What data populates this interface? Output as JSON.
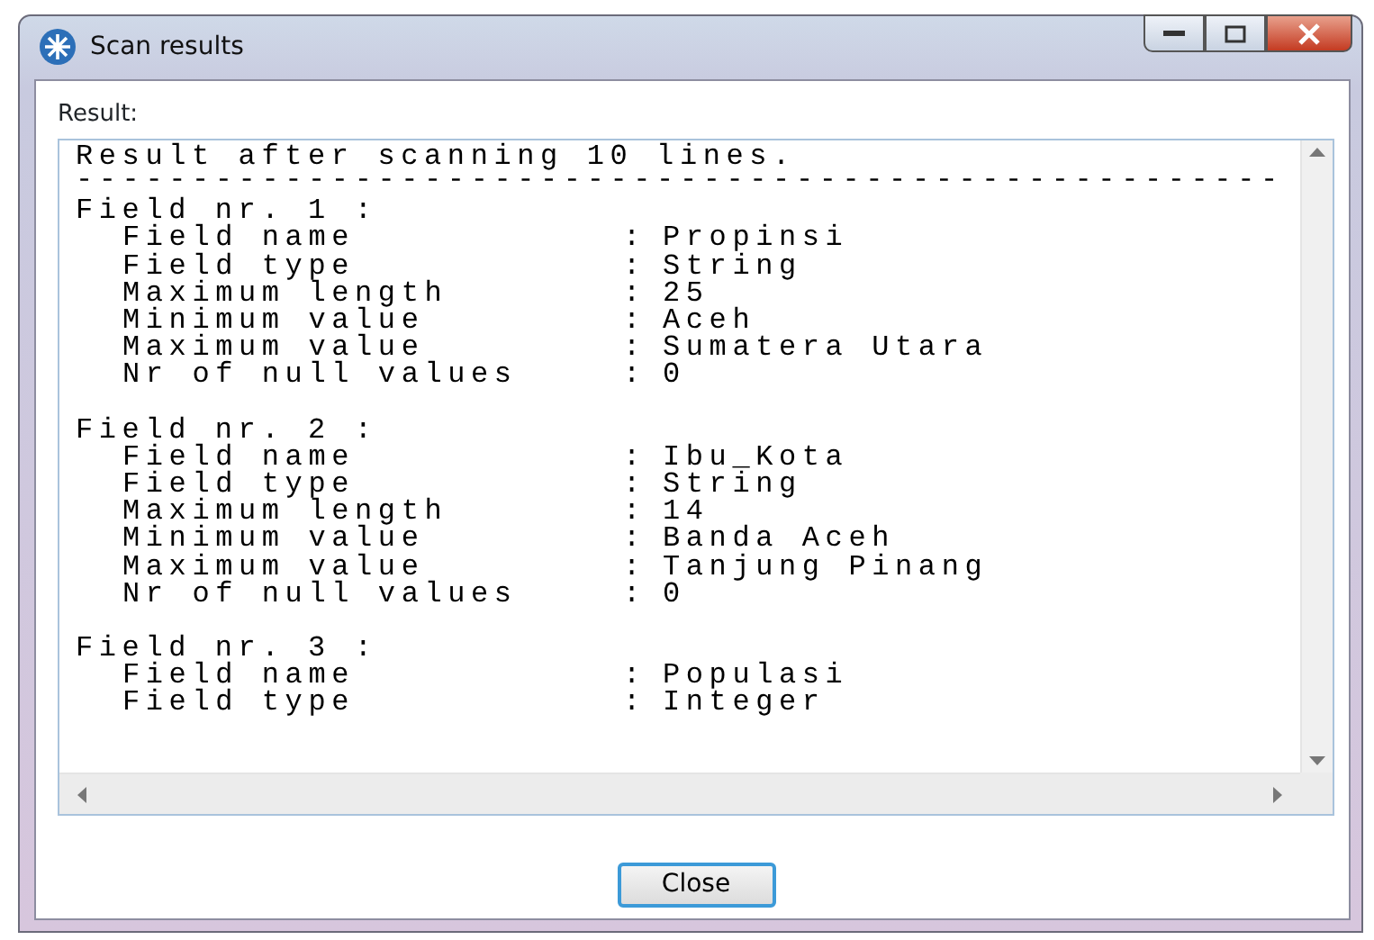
{
  "window": {
    "title": "Scan results"
  },
  "result_label": "Result:",
  "result": {
    "header": "Result after scanning 10 lines.",
    "separator": "----------------------------------------------------",
    "fields": [
      {
        "heading": "Field nr. 1 :",
        "rows": [
          {
            "label": "Field name",
            "colon": ":",
            "value": "Propinsi"
          },
          {
            "label": "Field type",
            "colon": ":",
            "value": "String"
          },
          {
            "label": "Maximum length",
            "colon": ":",
            "value": "25"
          },
          {
            "label": "Minimum value",
            "colon": ":",
            "value": "Aceh"
          },
          {
            "label": "Maximum value",
            "colon": ":",
            "value": "Sumatera Utara"
          },
          {
            "label": "Nr of null values",
            "colon": ":",
            "value": "0"
          }
        ]
      },
      {
        "heading": "Field nr. 2 :",
        "rows": [
          {
            "label": "Field name",
            "colon": ":",
            "value": "Ibu_Kota"
          },
          {
            "label": "Field type",
            "colon": ":",
            "value": "String"
          },
          {
            "label": "Maximum length",
            "colon": ":",
            "value": "14"
          },
          {
            "label": "Minimum value",
            "colon": ":",
            "value": "Banda Aceh"
          },
          {
            "label": "Maximum value",
            "colon": ":",
            "value": "Tanjung Pinang"
          },
          {
            "label": "Nr of null values",
            "colon": ":",
            "value": "0"
          }
        ]
      },
      {
        "heading": "Field nr. 3 :",
        "rows": [
          {
            "label": "Field name",
            "colon": ":",
            "value": "Populasi"
          },
          {
            "label": "Field type",
            "colon": ":",
            "value": "Integer"
          }
        ]
      }
    ]
  },
  "buttons": [
    "Close"
  ]
}
